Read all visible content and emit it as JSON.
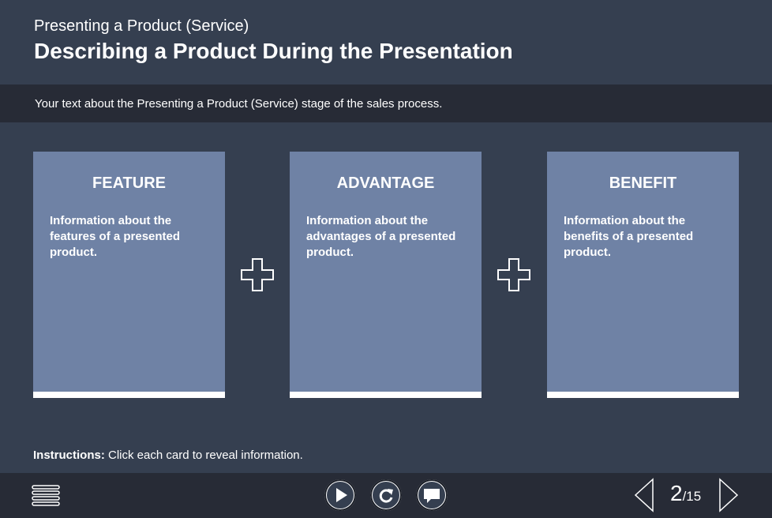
{
  "header": {
    "subtitle": "Presenting a Product (Service)",
    "title": "Describing a Product During the Presentation"
  },
  "intro": {
    "text": "Your text about the Presenting a Product (Service) stage of the sales process."
  },
  "cards": [
    {
      "title": "FEATURE",
      "text": "Information about the features of a presented product."
    },
    {
      "title": "ADVANTAGE",
      "text": "Information about the advantages of a presented product."
    },
    {
      "title": "BENEFIT",
      "text": "Information about the benefits of a presented product."
    }
  ],
  "instructions": {
    "label": "Instructions:",
    "text": "Click each card to reveal information."
  },
  "footer": {
    "icons": {
      "menu": "menu-icon",
      "play": "play-icon",
      "replay": "replay-icon",
      "comment": "comment-icon",
      "prev": "prev-arrow-icon",
      "next": "next-arrow-icon"
    },
    "page_current": "2",
    "page_total": "/15"
  },
  "colors": {
    "background": "#353f50",
    "bar": "#272b36",
    "card": "#6f82a5",
    "accent": "#ffffff"
  }
}
